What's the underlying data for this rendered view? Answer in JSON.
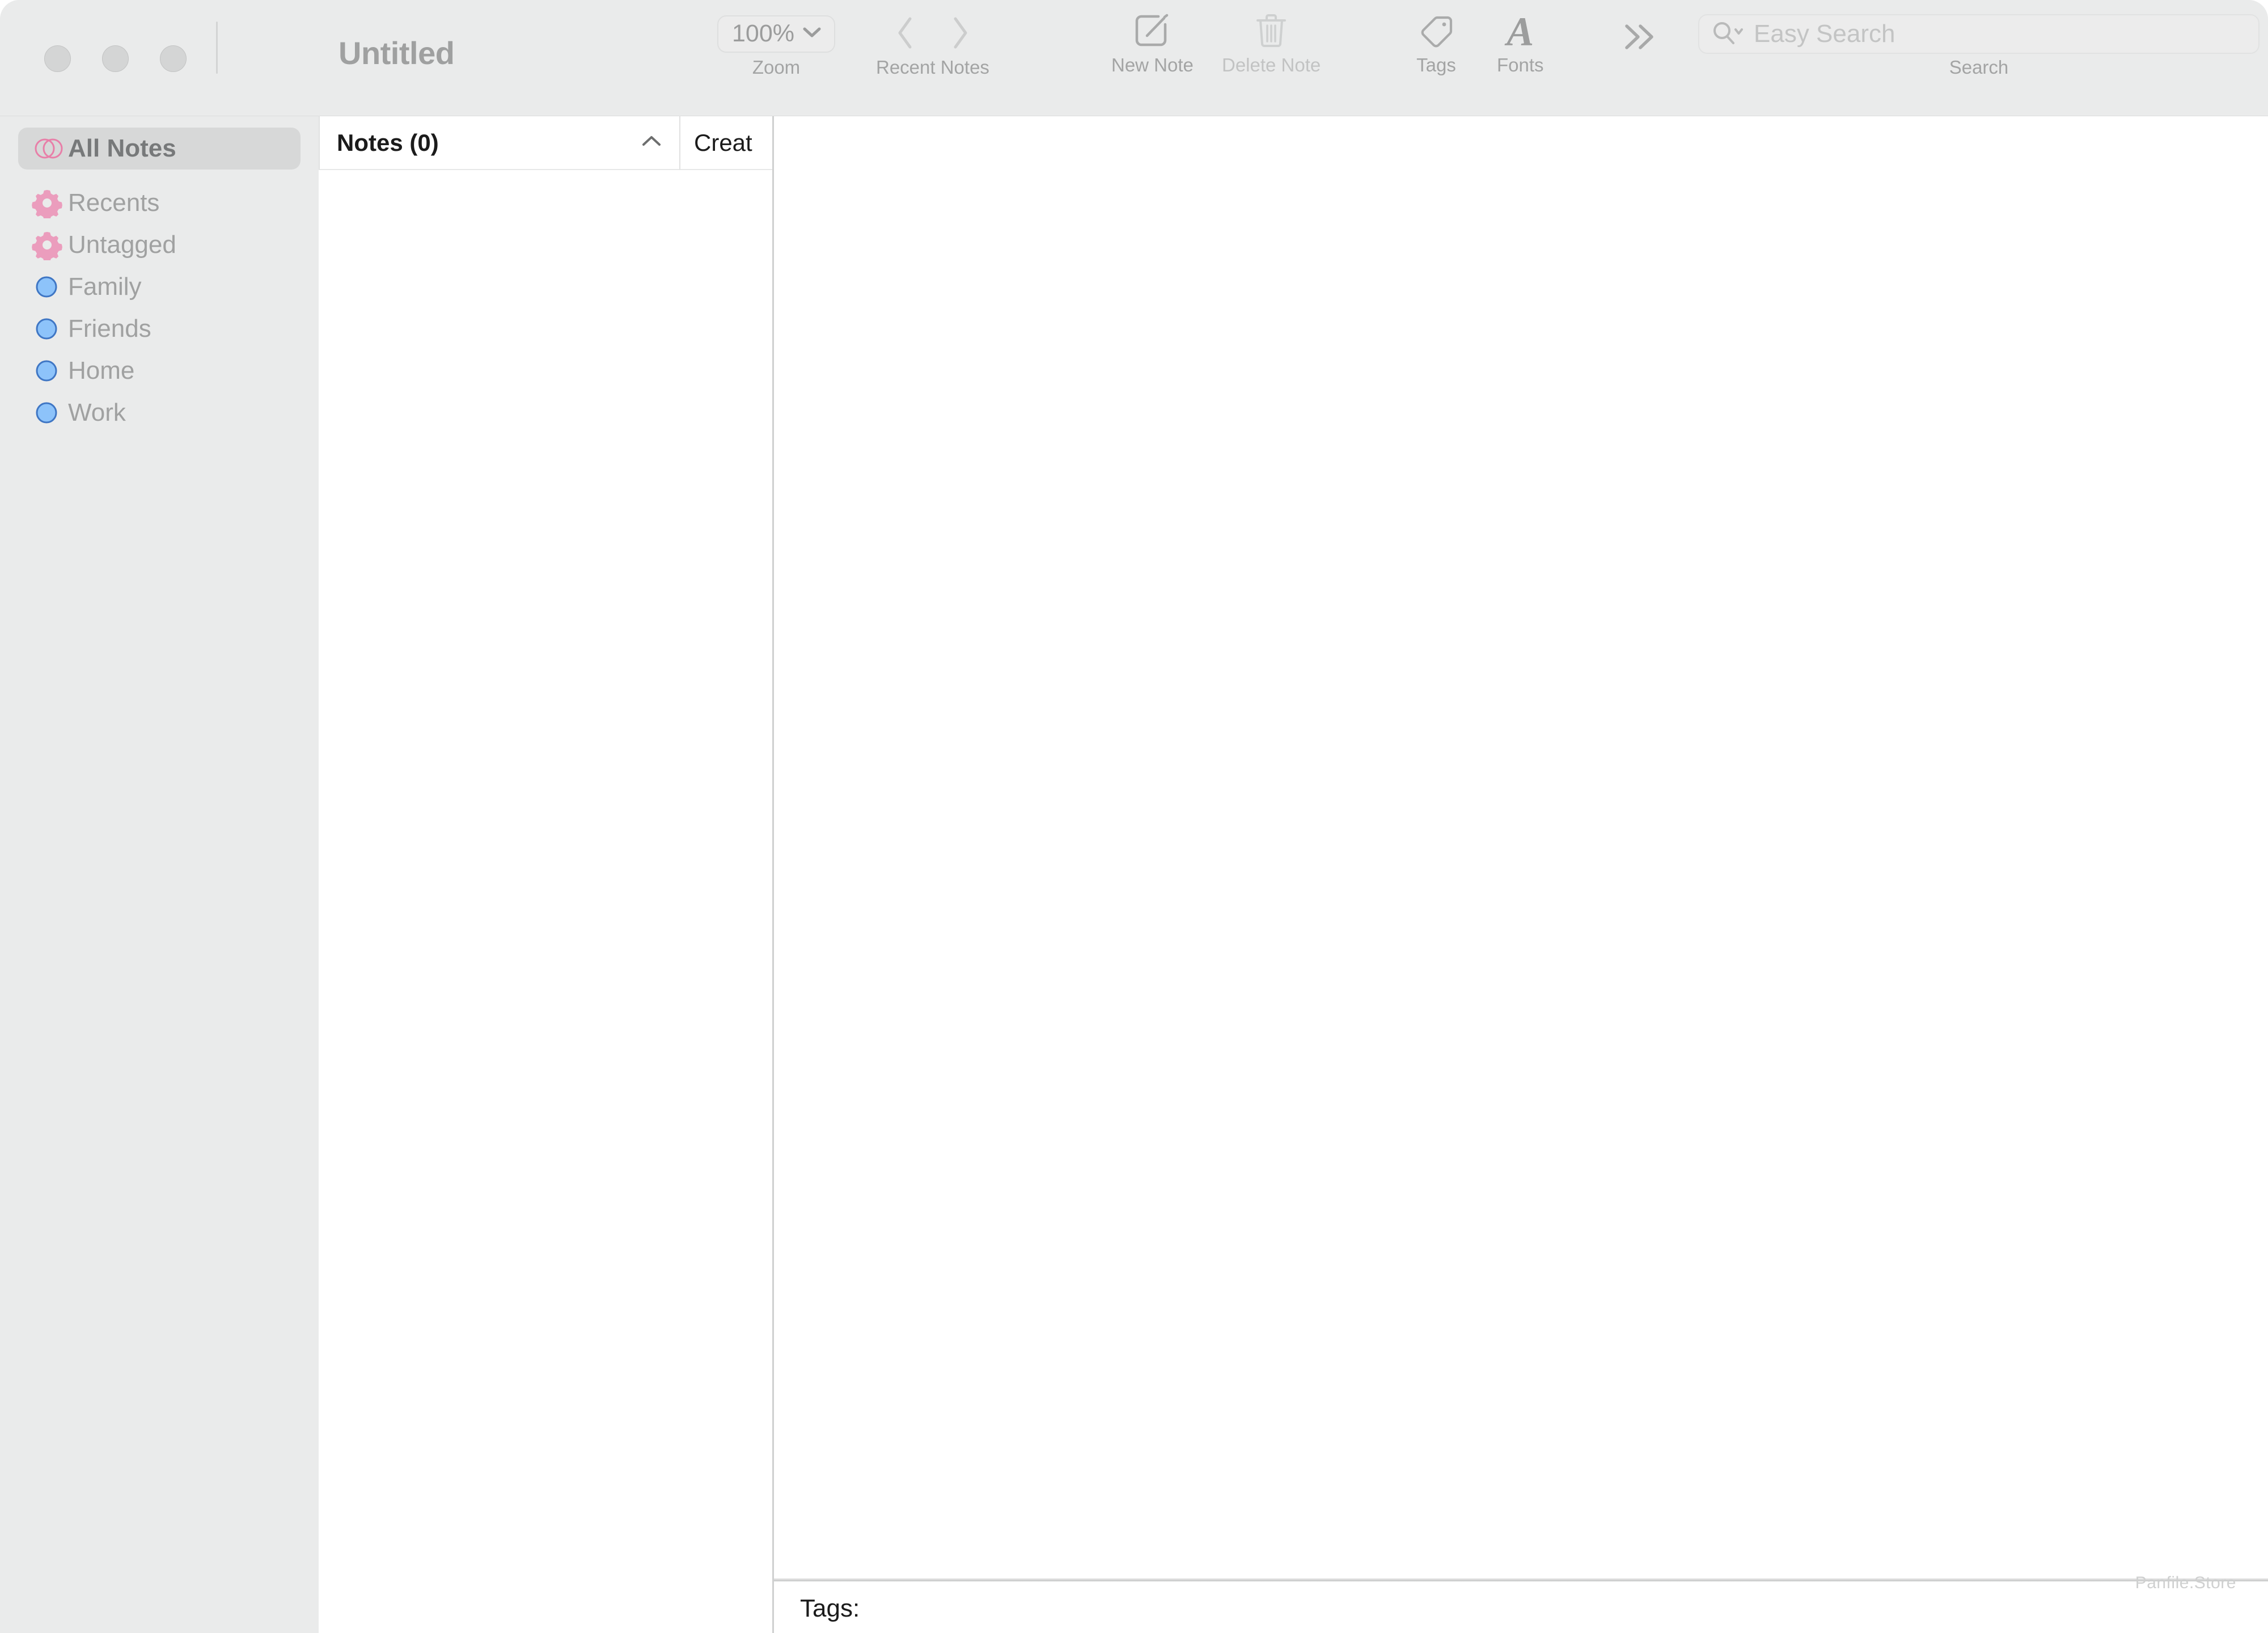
{
  "window": {
    "title": "Untitled",
    "traffic_lights": [
      "close",
      "minimize",
      "zoom"
    ],
    "accent_pink": "#e87fa8",
    "accent_blue": "#7ab6f5",
    "chrome_bg": "#eaebeb"
  },
  "toolbar": {
    "zoom": {
      "value": "100%",
      "label": "Zoom"
    },
    "recent_notes": {
      "label": "Recent Notes",
      "back_icon": "chevron-left-icon",
      "forward_icon": "chevron-right-icon"
    },
    "new_note": {
      "label": "New Note",
      "icon": "compose-note-icon"
    },
    "delete_note": {
      "label": "Delete Note",
      "icon": "trash-icon",
      "disabled": true
    },
    "tags": {
      "label": "Tags",
      "icon": "tag-icon"
    },
    "fonts": {
      "label": "Fonts",
      "icon": "font-a-icon"
    },
    "overflow": {
      "icon": "double-chevron-right-icon"
    },
    "search": {
      "label": "Search",
      "placeholder": "Easy Search",
      "value": "",
      "icon": "search-magnifier-icon"
    }
  },
  "sidebar": {
    "items": [
      {
        "label": "All Notes",
        "icon": "all-notes-circles-icon",
        "icon_kind": "circles",
        "selected": true
      },
      {
        "label": "Recents",
        "icon": "gear-icon",
        "icon_kind": "gear",
        "selected": false
      },
      {
        "label": "Untagged",
        "icon": "gear-icon",
        "icon_kind": "gear",
        "selected": false
      },
      {
        "label": "Family",
        "icon": "blue-dot-icon",
        "icon_kind": "dot",
        "selected": false
      },
      {
        "label": "Friends",
        "icon": "blue-dot-icon",
        "icon_kind": "dot",
        "selected": false
      },
      {
        "label": "Home",
        "icon": "blue-dot-icon",
        "icon_kind": "dot",
        "selected": false
      },
      {
        "label": "Work",
        "icon": "blue-dot-icon",
        "icon_kind": "dot",
        "selected": false
      }
    ]
  },
  "notes_list": {
    "columns": {
      "title": "Notes (0)",
      "created": "Creat",
      "sort_icon": "chevron-up-icon"
    },
    "rows": [],
    "count": 0
  },
  "editor": {
    "content": "",
    "tags_label": "Tags:",
    "tags_value": ""
  },
  "watermark": {
    "text": "Panfile.Store"
  }
}
